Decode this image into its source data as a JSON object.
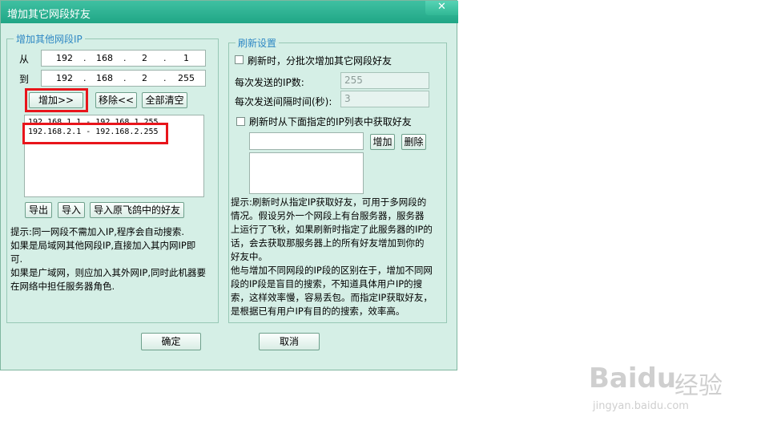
{
  "window": {
    "title": "增加其它网段好友",
    "close_glyph": "✕"
  },
  "left_group": {
    "legend": "增加其他网段IP",
    "from_label": "从",
    "to_label": "到",
    "from_ip": [
      "192",
      "168",
      "2",
      "1"
    ],
    "to_ip": [
      "192",
      "168",
      "2",
      "255"
    ],
    "dot": ".",
    "add_button": "增加>>",
    "remove_button": "移除<<",
    "clear_button": "全部清空",
    "ranges": [
      "192.168.1.1 - 192.168.1.255",
      "192.168.2.1 - 192.168.2.255"
    ],
    "export_button": "导出",
    "import_button": "导入",
    "import_feige_button": "导入原飞鸽中的好友",
    "hint": [
      "提示:同一网段不需加入IP,程序会自动搜索.",
      "如果是局域网其他网段IP,直接加入其内网IP即",
      "可.",
      "如果是广域网，则应加入其外网IP,同时此机器要",
      "在网络中担任服务器角色."
    ]
  },
  "right_group": {
    "legend": "刷新设置",
    "batch_checkbox_label": "刷新时，分批次增加其它网段好友",
    "ip_count_label": "每次发送的IP数:",
    "ip_count_value": "255",
    "interval_label": "每次发送间隔时间(秒):",
    "interval_value": "3",
    "list_checkbox_label": "刷新时从下面指定的IP列表中获取好友",
    "add_button": "增加",
    "delete_button": "删除",
    "hint": [
      "提示:刷新时从指定IP获取好友，可用于多网段的",
      "情况。假设另外一个网段上有台服务器，服务器",
      "上运行了飞秋，如果刷新时指定了此服务器的IP的",
      "话，会去获取那服务器上的所有好友增加到你的",
      "好友中。",
      "他与增加不同网段的IP段的区别在于，增加不同网",
      "段的IP段是盲目的搜索，不知道具体用户IP的搜",
      "索，这样效率慢，容易丢包。而指定IP获取好友，",
      "是根据已有用户IP有目的的搜索，效率高。"
    ]
  },
  "footer": {
    "ok_button": "确定",
    "cancel_button": "取消"
  },
  "watermark": {
    "brand": "Baidu",
    "cn": "经验",
    "url": "jingyan.baidu.com"
  },
  "colors": {
    "title_bar": "#20a686",
    "dialog_bg": "#d5efe6",
    "legend_text": "#2f88c4",
    "highlight_box": "#e8151b"
  }
}
